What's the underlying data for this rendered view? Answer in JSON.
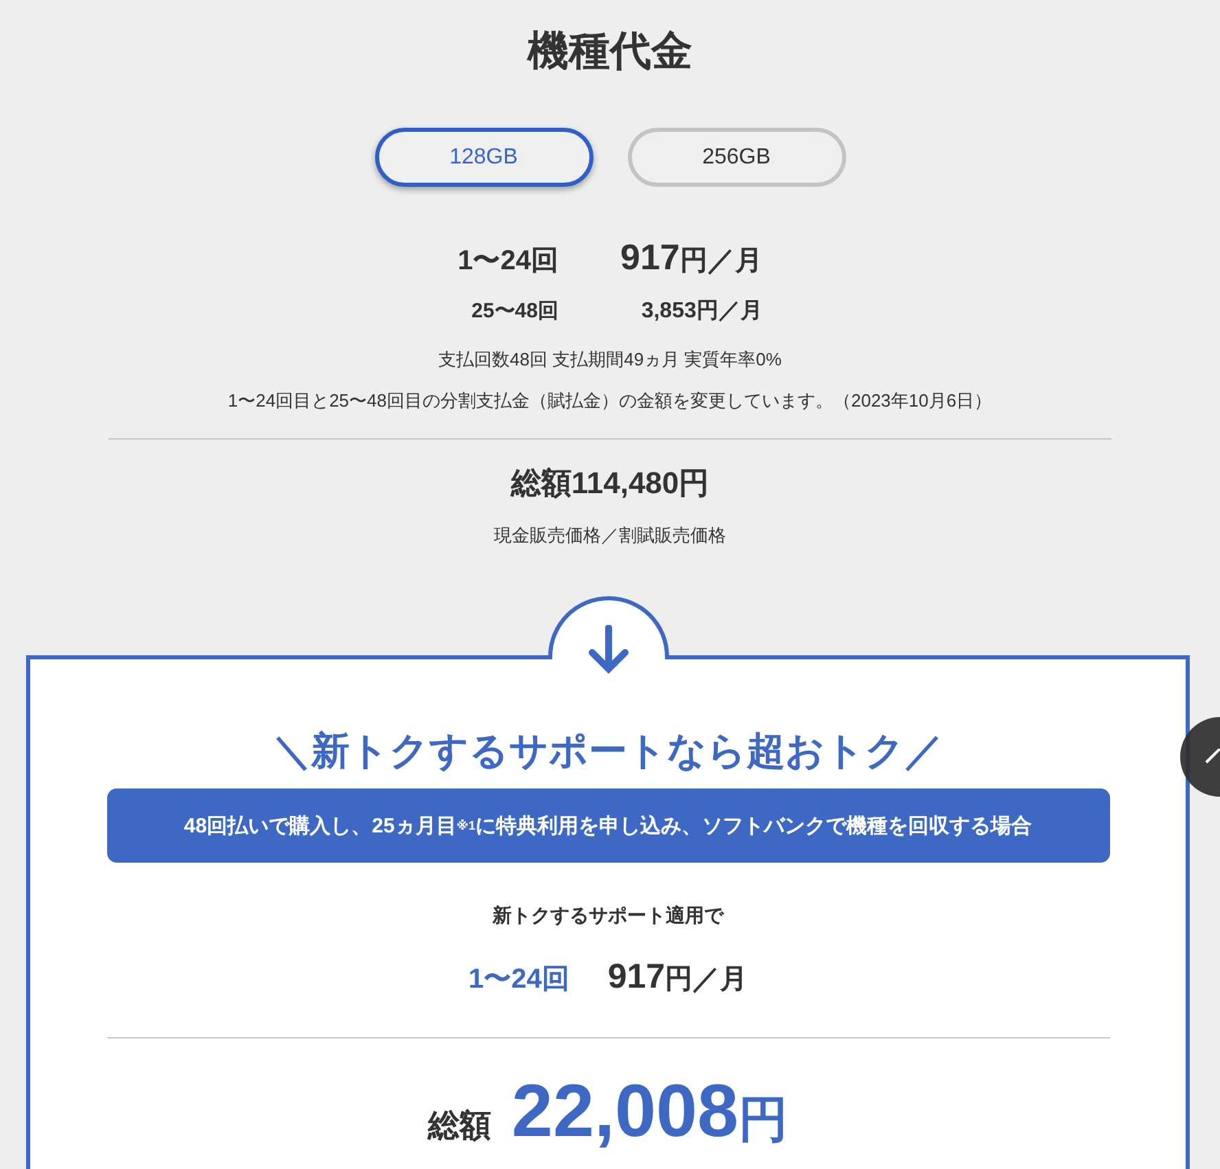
{
  "title": "機種代金",
  "capacity_tabs": [
    {
      "label": "128GB",
      "selected": true
    },
    {
      "label": "256GB",
      "selected": false
    }
  ],
  "installments": [
    {
      "kind": "primary",
      "period": "1〜24回",
      "amount": "917",
      "unit": "円／月"
    },
    {
      "kind": "secondary",
      "period": "25〜48回",
      "amount": "3,853",
      "unit": "円／月"
    }
  ],
  "payment_terms": "支払回数48回 支払期間49ヵ月 実質年率0%",
  "change_notice": "1〜24回目と25〜48回目の分割支払金（賦払金）の金額を変更しています。（2023年10月6日）",
  "total": "総額114,480円",
  "total_note": "現金販売価格／割賦販売価格",
  "support_card": {
    "heading": "＼新トクするサポートなら超おトク／",
    "condition": "48回払いで購入し、25ヵ月目$^{※1}$に特典利用を申し込み、ソフトバンクで機種を回収する場合",
    "applied_label": "新トクするサポート適用で",
    "installment": {
      "period": "1〜24回",
      "amount": "917",
      "unit": "円／月"
    },
    "total_label": "総額",
    "total_amount": "22,008",
    "total_unit": "円"
  }
}
